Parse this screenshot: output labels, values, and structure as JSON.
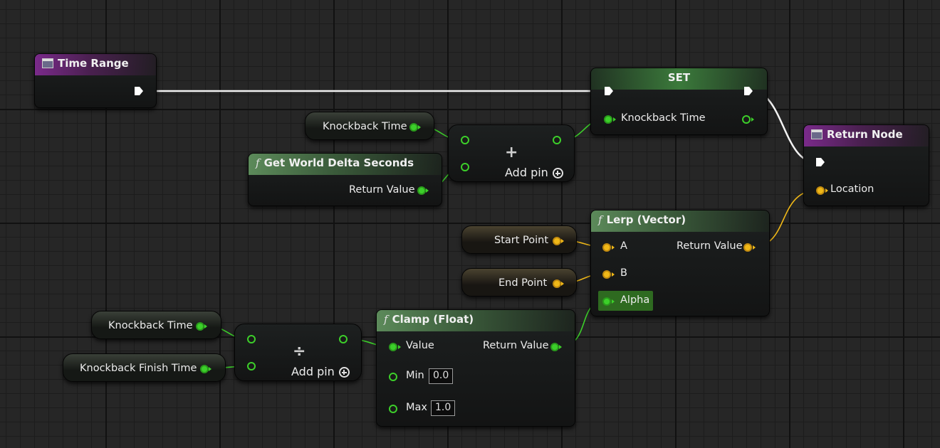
{
  "nodes": {
    "time_range": {
      "title": "Time Range"
    },
    "set": {
      "title": "SET",
      "pin_label": "Knockback Time"
    },
    "return_node": {
      "title": "Return Node",
      "location_label": "Location"
    },
    "add_top": {
      "symbol": "+",
      "add_pin_label": "Add pin"
    },
    "get_world_delta": {
      "title": "Get World Delta Seconds",
      "return_label": "Return Value"
    },
    "lerp": {
      "title": "Lerp (Vector)",
      "a_label": "A",
      "b_label": "B",
      "alpha_label": "Alpha",
      "return_label": "Return Value"
    },
    "divide": {
      "symbol": "÷",
      "add_pin_label": "Add pin"
    },
    "clamp": {
      "title": "Clamp (Float)",
      "value_label": "Value",
      "min_label": "Min",
      "min_value": "0.0",
      "max_label": "Max",
      "max_value": "1.0",
      "return_label": "Return Value"
    }
  },
  "variables": {
    "knockback_time_top": "Knockback Time",
    "start_point": "Start Point",
    "end_point": "End Point",
    "knockback_time_bottom": "Knockback Time",
    "knockback_finish_time": "Knockback Finish Time"
  },
  "colors": {
    "float_pin": "#3ccf2a",
    "vector_pin": "#f0b818",
    "exec_wire": "#ffffff",
    "function_header": "#5c8a5a",
    "event_header": "#7a2a8a"
  },
  "icons": {
    "function": "f",
    "event": "window-icon",
    "add_pin": "plus-circle-icon"
  }
}
